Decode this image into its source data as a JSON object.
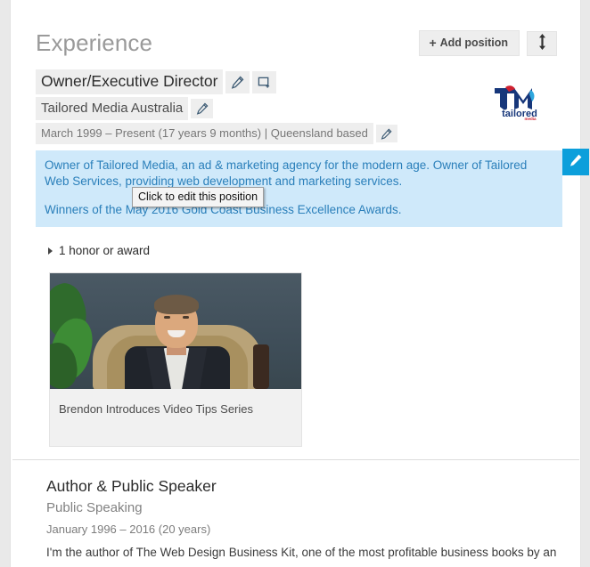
{
  "section": {
    "title": "Experience",
    "add_position_label": "Add position",
    "add_icon": "plus-icon",
    "reorder_icon": "up-down-arrows-icon"
  },
  "positions": [
    {
      "title": "Owner/Executive Director",
      "company": "Tailored Media Australia",
      "dates": "March 1999 – Present (17 years 9 months)  |  Queensland based",
      "edit_title_icon": "pencil-icon",
      "add_media_icon": "add-media-frame-icon",
      "edit_company_icon": "pencil-icon",
      "edit_dates_icon": "pencil-icon",
      "logo_alt": "tailored media",
      "logo_primary_color": "#16367a",
      "logo_accent_color": "#cf2030",
      "logo_light_color": "#2ea7de",
      "logo_wordmark": "tailored",
      "logo_subwordmark": "media",
      "description": [
        "Owner of Tailored Media, an ad & marketing agency for the modern age. Owner of Tailored Web Services, providing web development and marketing services.",
        "Winners of the May 2016 Gold Coast Business Excellence Awards."
      ],
      "description_edit_icon": "pencil-icon",
      "tooltip": "Click to edit this position",
      "honors_label": "1 honor or award",
      "media": {
        "caption": "Brendon Introduces Video Tips Series"
      }
    },
    {
      "title": "Author & Public Speaker",
      "company": "Public Speaking",
      "dates": "January 1996 – 2016 (20 years)",
      "description": "I'm the author of The Web Design Business Kit, one of the most profitable business books by an"
    }
  ],
  "colors": {
    "highlight_bg": "#cfe9fa",
    "highlight_text": "#2a7fba",
    "edit_button_bg": "#0c9fdb",
    "field_chip_bg": "#eeeeee",
    "page_bg": "#e9e9e9"
  }
}
